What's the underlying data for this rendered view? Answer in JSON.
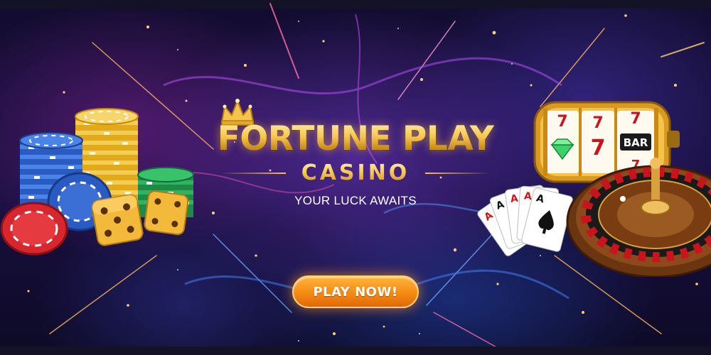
{
  "banner": {
    "brand_title": "FORTUNE PLAY",
    "brand_subtitle": "CASINO",
    "tagline": "YOUR LUCK AWAITS",
    "cta_label": "PLAY NOW!"
  },
  "slot_machine": {
    "reels": [
      "7",
      "7",
      "7",
      "7",
      "BAR",
      "7"
    ]
  },
  "playing_cards": {
    "ranks": [
      "A",
      "A",
      "A",
      "A",
      "A"
    ]
  },
  "colors": {
    "gold": "#f6c44e",
    "cta_orange": "#f58a12",
    "background": "#1a1042"
  },
  "icons": [
    "crown-icon",
    "poker-chips",
    "dice",
    "slot-machine",
    "playing-cards",
    "roulette-wheel"
  ]
}
